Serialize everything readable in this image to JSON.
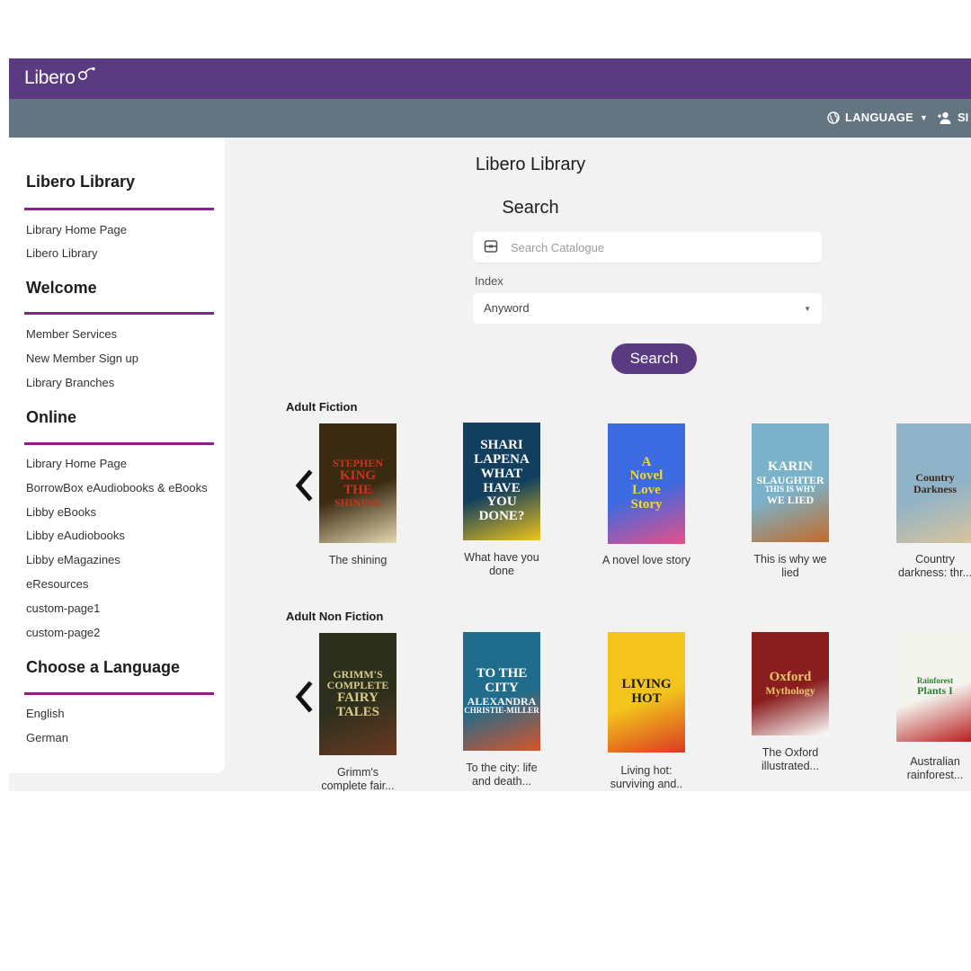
{
  "header": {
    "logo_text": "Libero",
    "language_label": "LANGUAGE",
    "signin_label": "SI"
  },
  "sidebar": {
    "sections": [
      {
        "heading": "Libero Library",
        "links": [
          "Library Home Page",
          "Libero Library"
        ]
      },
      {
        "heading": "Welcome",
        "links": [
          "Member Services",
          "New Member Sign up",
          "Library Branches"
        ]
      },
      {
        "heading": "Online",
        "links": [
          "Library Home Page",
          "BorrowBox eAudiobooks & eBooks",
          "Libby eBooks",
          "Libby eAudiobooks",
          "Libby eMagazines",
          "eResources",
          "custom-page1",
          "custom-page2"
        ]
      },
      {
        "heading": "Choose a Language",
        "links": [
          "English",
          "German"
        ]
      }
    ]
  },
  "main": {
    "title": "Libero Library",
    "search_heading": "Search",
    "search_placeholder": "Search Catalogue",
    "index_label": "Index",
    "index_value": "Anyword",
    "search_button": "Search"
  },
  "carousels": [
    {
      "title": "Adult Fiction",
      "books": [
        {
          "title": "The shining",
          "cover_lines": [
            "STEPHEN",
            "KING",
            "THE",
            "SHINING"
          ],
          "colors": [
            "#3a2a12",
            "#c8341c",
            "#e4d9b0"
          ]
        },
        {
          "title": "What have you done",
          "cover_lines": [
            "SHARI",
            "LAPENA",
            "WHAT",
            "HAVE",
            "YOU",
            "DONE?"
          ],
          "colors": [
            "#123f5e",
            "#ffffff",
            "#f0c419"
          ]
        },
        {
          "title": "A novel love story",
          "cover_lines": [
            "A",
            "Novel",
            "Love",
            "Story"
          ],
          "colors": [
            "#3c6ae0",
            "#f5d632",
            "#e94f8a"
          ]
        },
        {
          "title": "This is why we lied",
          "cover_lines": [
            "KARIN",
            "SLAUGHTER",
            "THIS IS WHY",
            "WE LIED"
          ],
          "colors": [
            "#7ab3c9",
            "#ffffff",
            "#c46a2a"
          ]
        },
        {
          "title": "Country darkness: thr...",
          "cover_lines": [
            "Country",
            "Darkness"
          ],
          "colors": [
            "#8fb3c8",
            "#3b2a1e",
            "#d9c49a"
          ]
        }
      ]
    },
    {
      "title": "Adult Non Fiction",
      "books": [
        {
          "title": "Grimm's complete fair...",
          "cover_lines": [
            "GRIMM'S",
            "COMPLETE",
            "FAIRY",
            "TALES"
          ],
          "colors": [
            "#2b2f1c",
            "#d9c98a",
            "#6b3a22"
          ]
        },
        {
          "title": "To the city: life and death...",
          "cover_lines": [
            "TO THE",
            "CITY",
            "ALEXANDRA",
            "CHRISTIE-MILLER"
          ],
          "colors": [
            "#1f6c8c",
            "#ffffff",
            "#d9542a"
          ]
        },
        {
          "title": "Living hot: surviving and..",
          "cover_lines": [
            "LIVING",
            "HOT"
          ],
          "colors": [
            "#f3c41c",
            "#1b1b1b",
            "#d93a20"
          ]
        },
        {
          "title": "The Oxford illustrated...",
          "cover_lines": [
            "Oxford",
            "Mythology"
          ],
          "colors": [
            "#8a1e1e",
            "#e9c66a",
            "#ffffff"
          ]
        },
        {
          "title": "Australian rainforest...",
          "cover_lines": [
            "Rainforest",
            "Plants I"
          ],
          "colors": [
            "#f4f4ef",
            "#2e7d32",
            "#b71c1c"
          ]
        }
      ]
    }
  ]
}
